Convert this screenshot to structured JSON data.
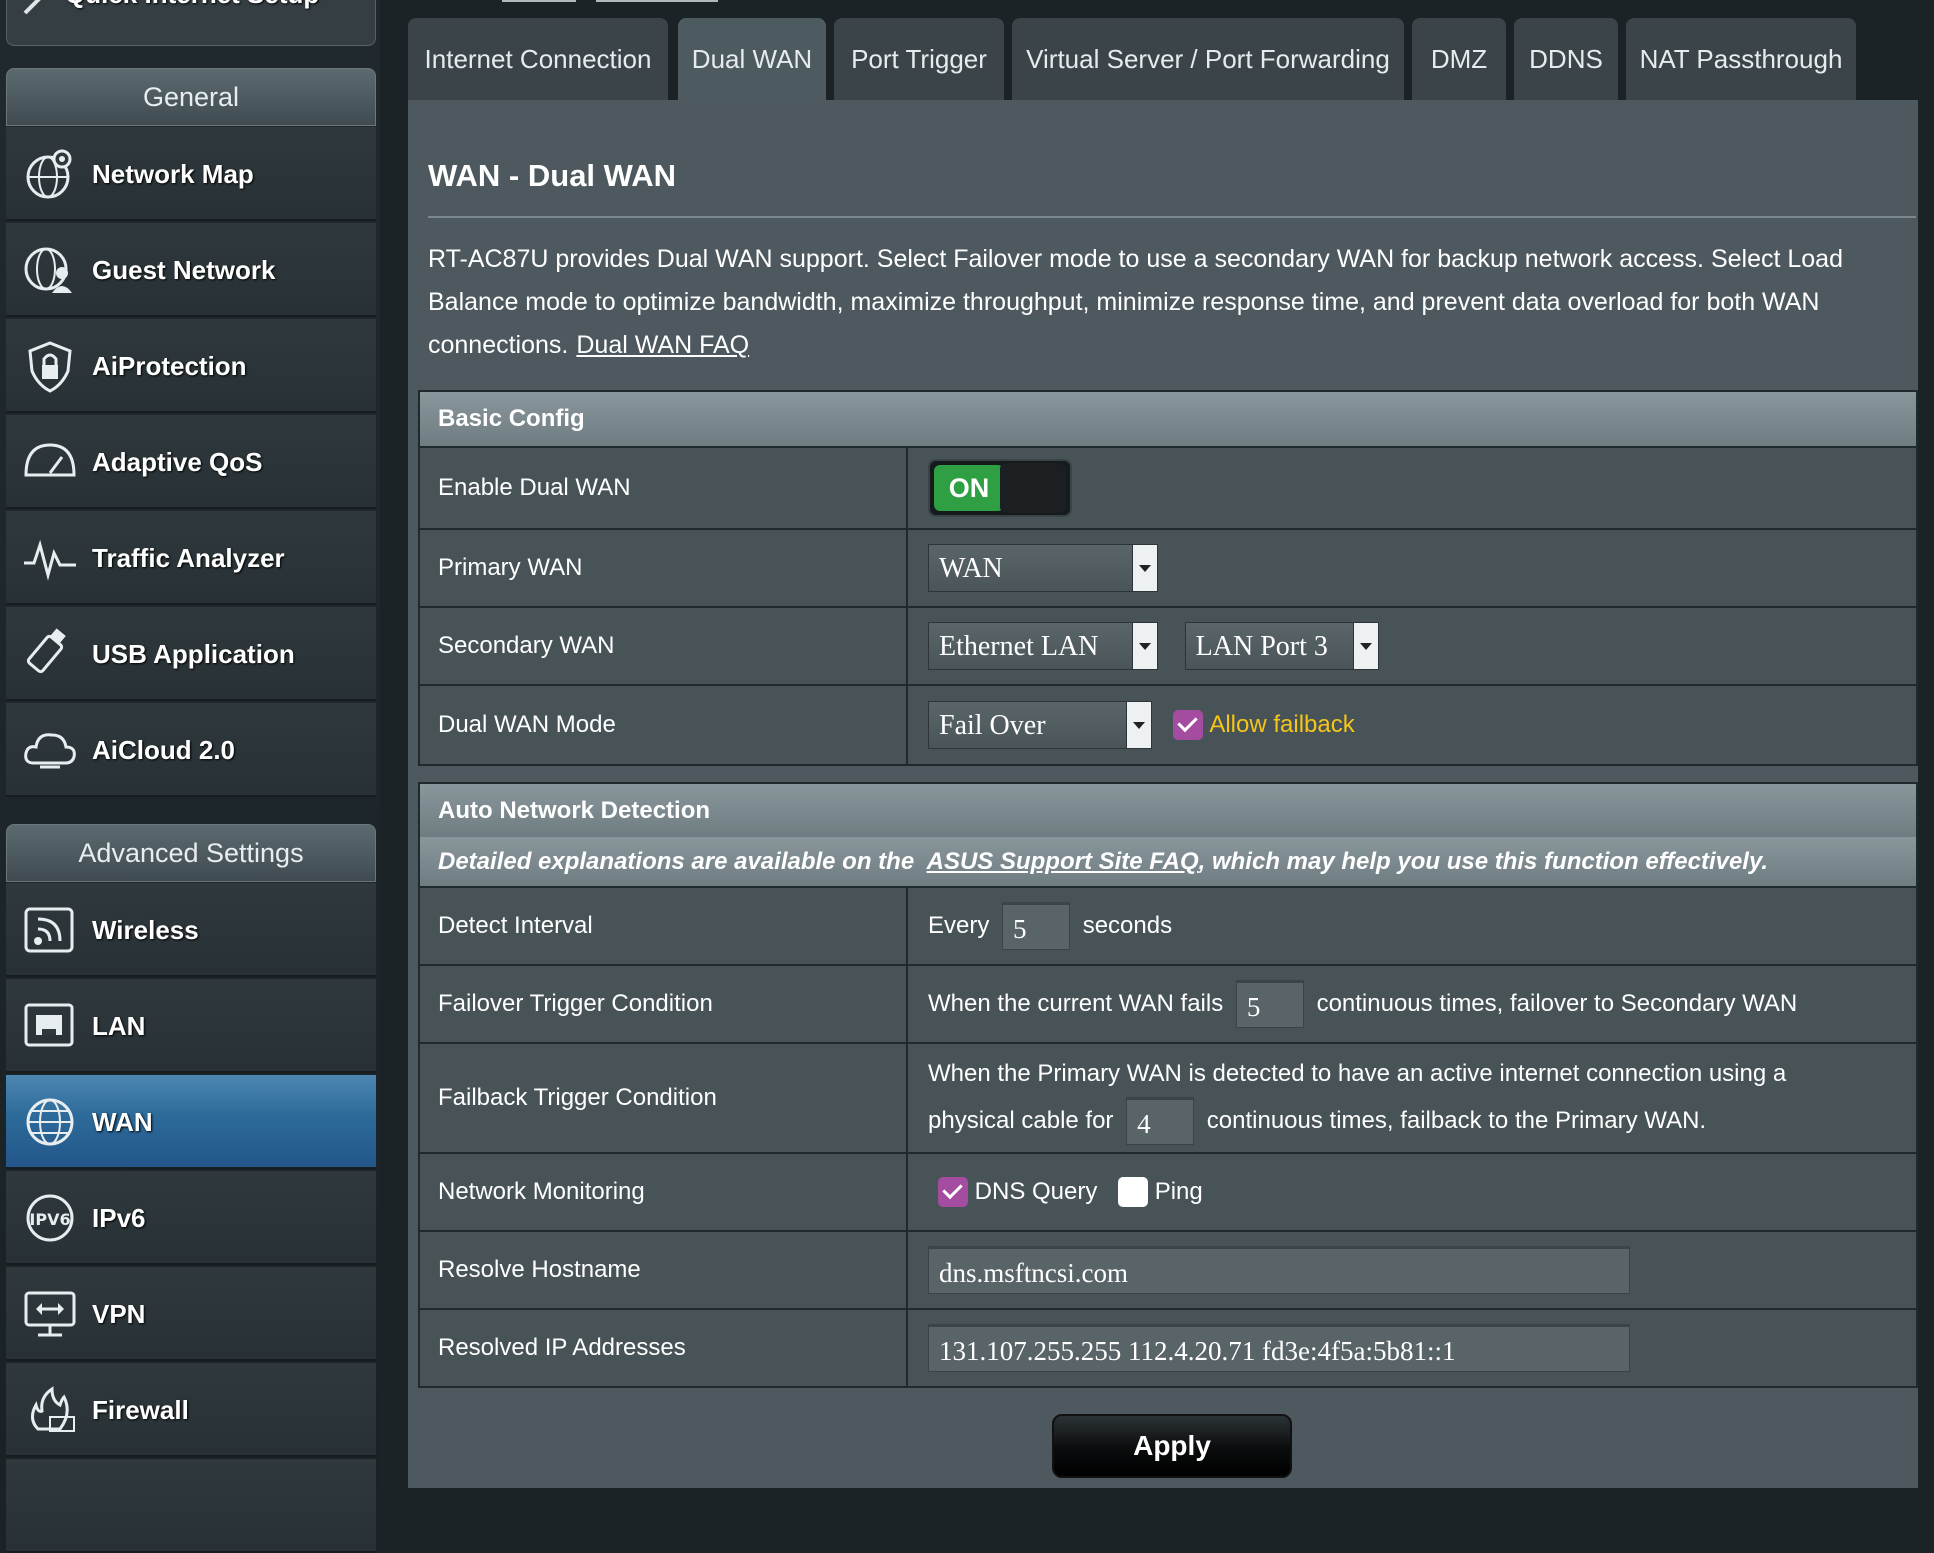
{
  "sidebar": {
    "quick_setup_label": "Quick Internet Setup",
    "general_label": "General",
    "general_items": [
      {
        "label": "Network Map",
        "icon": "network-map-icon"
      },
      {
        "label": "Guest Network",
        "icon": "guest-network-icon"
      },
      {
        "label": "AiProtection",
        "icon": "aiprotection-icon"
      },
      {
        "label": "Adaptive QoS",
        "icon": "qos-gauge-icon"
      },
      {
        "label": "Traffic Analyzer",
        "icon": "traffic-analyzer-icon"
      },
      {
        "label": "USB Application",
        "icon": "usb-icon"
      },
      {
        "label": "AiCloud 2.0",
        "icon": "cloud-icon"
      }
    ],
    "advanced_label": "Advanced Settings",
    "advanced_items": [
      {
        "label": "Wireless",
        "icon": "wireless-icon"
      },
      {
        "label": "LAN",
        "icon": "lan-icon"
      },
      {
        "label": "WAN",
        "icon": "wan-globe-icon",
        "active": true
      },
      {
        "label": "IPv6",
        "icon": "ipv6-icon"
      },
      {
        "label": "VPN",
        "icon": "vpn-icon"
      },
      {
        "label": "Firewall",
        "icon": "firewall-icon"
      }
    ]
  },
  "tabs": [
    {
      "label": "Internet Connection"
    },
    {
      "label": "Dual WAN",
      "active": true
    },
    {
      "label": "Port Trigger"
    },
    {
      "label": "Virtual Server / Port Forwarding"
    },
    {
      "label": "DMZ"
    },
    {
      "label": "DDNS"
    },
    {
      "label": "NAT Passthrough"
    }
  ],
  "page": {
    "title": "WAN - Dual WAN",
    "description": "RT-AC87U provides Dual WAN support. Select Failover mode to use a secondary WAN for backup network access. Select Load Balance mode to optimize bandwidth, maximize throughput, minimize response time, and prevent data overload for both WAN connections.",
    "faq_link": "Dual WAN FAQ"
  },
  "basic_config": {
    "header": "Basic Config",
    "enable_label": "Enable Dual WAN",
    "enable_toggle": "ON",
    "primary_label": "Primary WAN",
    "primary_value": "WAN",
    "secondary_label": "Secondary WAN",
    "secondary_value": "Ethernet LAN",
    "secondary_port": "LAN Port 3",
    "mode_label": "Dual WAN Mode",
    "mode_value": "Fail Over",
    "allow_failback": "Allow failback"
  },
  "auto_detection": {
    "header": "Auto Network Detection",
    "note_prefix": "Detailed explanations are available on the",
    "note_link": "ASUS Support Site FAQ",
    "note_suffix": ", which may help you use this function effectively.",
    "detect_label": "Detect Interval",
    "detect_prefix": "Every",
    "detect_value": "5",
    "detect_suffix": "seconds",
    "failover_label": "Failover Trigger Condition",
    "failover_prefix": "When the current WAN fails",
    "failover_value": "5",
    "failover_suffix": "continuous times, failover to Secondary WAN",
    "failback_label": "Failback Trigger Condition",
    "failback_line1": "When the Primary WAN is detected to have an active internet connection using a",
    "failback_prefix": "physical cable for",
    "failback_value": "4",
    "failback_suffix": "continuous times, failback to the Primary WAN.",
    "monitor_label": "Network Monitoring",
    "monitor_dns": "DNS Query",
    "monitor_ping": "Ping",
    "hostname_label": "Resolve Hostname",
    "hostname_value": "dns.msftncsi.com",
    "resolved_label": "Resolved IP Addresses",
    "resolved_value": "131.107.255.255 112.4.20.71 fd3e:4f5a:5b81::1"
  },
  "apply_label": "Apply",
  "colors": {
    "accent_toggle": "#2ea043",
    "checkbox_checked": "#a34ca0",
    "failback_text": "#f5c518",
    "active_nav": "#2c6a99"
  }
}
